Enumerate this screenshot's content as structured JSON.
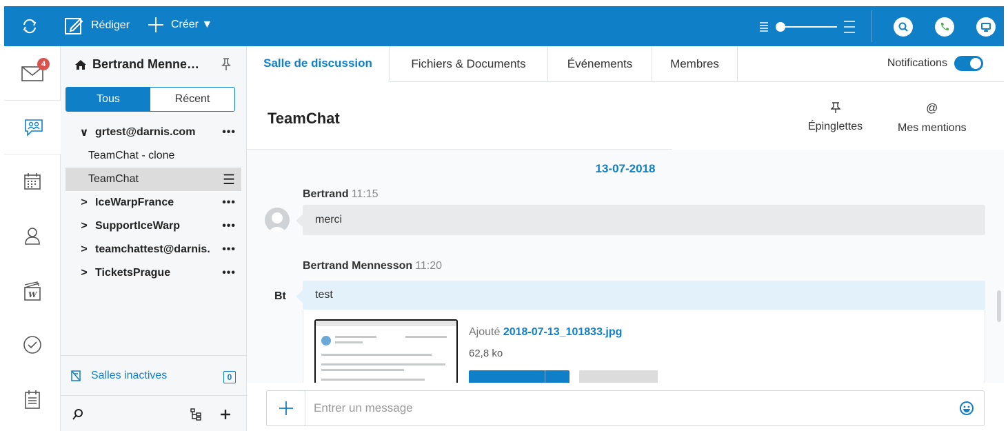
{
  "colors": {
    "brand": "#0f7fc7",
    "badge": "#d9534f",
    "selected_row": "#dcdcdc"
  },
  "topbar": {
    "compose_label": "Rédiger",
    "create_label": "Créer ▼",
    "icons": [
      "refresh-icon",
      "compose-icon",
      "plus-icon",
      "density-slider",
      "search-icon",
      "phone-icon",
      "screen-icon"
    ]
  },
  "rail": {
    "mail_badge": "4",
    "items": [
      "mail-icon",
      "teamchat-icon",
      "calendar-icon",
      "contacts-icon",
      "documents-icon",
      "tasks-icon",
      "notes-icon"
    ]
  },
  "rooms": {
    "owner": "Bertrand Menne…",
    "filter": {
      "all": "Tous",
      "recent": "Récent"
    },
    "items": [
      {
        "name": "grtest@darnis.com",
        "chevron": "∨",
        "more": "•••"
      },
      {
        "name": "TeamChat - clone"
      },
      {
        "name": "TeamChat",
        "menu": "☰"
      },
      {
        "name": "IceWarpFrance",
        "chevron": ">",
        "more": "•••"
      },
      {
        "name": "SupportIceWarp",
        "chevron": ">",
        "more": "•••"
      },
      {
        "name": "teamchattest@darnis.",
        "chevron": ">",
        "more": "•••"
      },
      {
        "name": "TicketsPrague",
        "chevron": ">",
        "more": "•••"
      }
    ],
    "inactive_label": "Salles inactives",
    "inactive_count": "0"
  },
  "tabs": [
    "Salle de discussion",
    "Fichiers & Documents",
    "Événements",
    "Membres"
  ],
  "notifications_label": "Notifications",
  "notifications_on": true,
  "chat": {
    "title": "TeamChat",
    "pinned_label": "Épinglettes",
    "mentions_label": "Mes mentions",
    "mentions_symbol": "@",
    "date": "13-07-2018",
    "messages": [
      {
        "author": "Bertrand",
        "time": "11:15",
        "text": "merci"
      },
      {
        "author": "Bertrand Mennesson",
        "time": "11:20",
        "avatar_text": "Bt",
        "text": "test",
        "attachment": {
          "added_prefix": "Ajouté",
          "filename": "2018-07-13_101833.jpg",
          "size": "62,8 ko"
        }
      }
    ]
  },
  "composer": {
    "placeholder": "Entrer un message"
  }
}
